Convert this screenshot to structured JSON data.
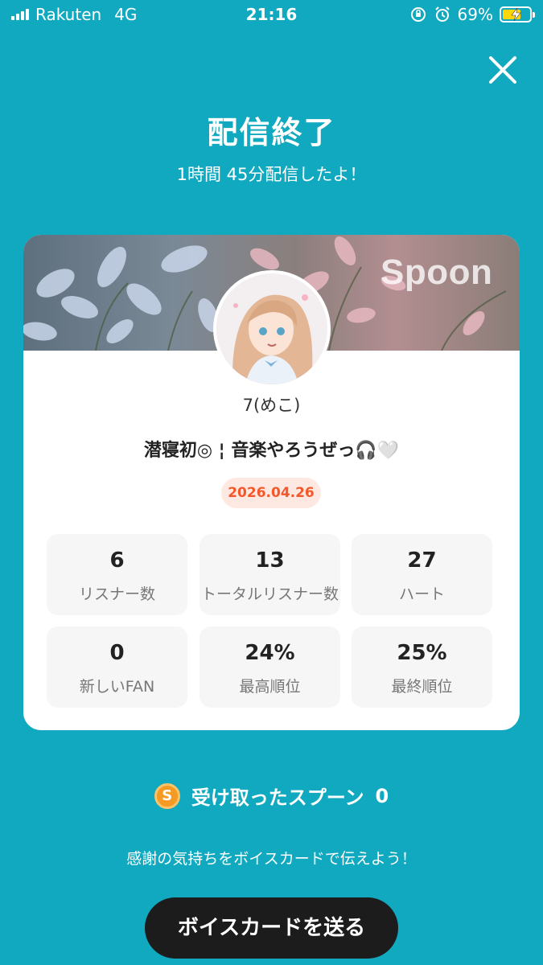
{
  "status_bar": {
    "carrier": "Rakuten",
    "network": "4G",
    "time": "21:16",
    "battery_percent": "69%",
    "battery_level": 0.69,
    "icons": [
      "signal-icon",
      "orientation-lock-icon",
      "alarm-icon",
      "battery-charging-icon"
    ]
  },
  "header": {
    "title": "配信終了",
    "subtitle": "1時間 45分配信したよ！",
    "close_icon": "close-icon"
  },
  "card": {
    "logo": "Spoon",
    "username": "7(めこ)",
    "live_title": "潜寝初◎ ¦ 音楽やろうぜっ🎧🤍",
    "date": "2026.04.26",
    "stats": [
      {
        "value": "6",
        "label": "リスナー数"
      },
      {
        "value": "13",
        "label": "トータルリスナー数"
      },
      {
        "value": "27",
        "label": "ハート"
      },
      {
        "value": "0",
        "label": "新しいFAN"
      },
      {
        "value": "24%",
        "label": "最高順位"
      },
      {
        "value": "25%",
        "label": "最終順位"
      }
    ]
  },
  "spoons": {
    "icon_letter": "S",
    "label": "受け取ったスプーン",
    "count": "0"
  },
  "footer": {
    "message": "感謝の気持ちをボイスカードで伝えよう！",
    "button_label": "ボイスカードを送る"
  },
  "colors": {
    "background": "#10a9bf",
    "date_text": "#f4582a",
    "date_bg": "#fde9e2",
    "button": "#1c1c1c"
  }
}
